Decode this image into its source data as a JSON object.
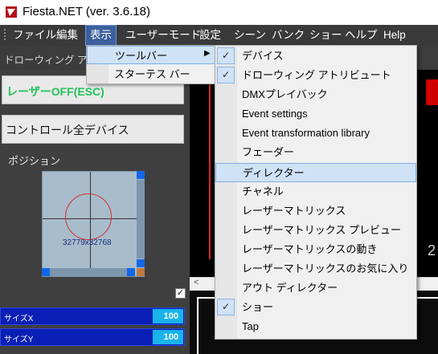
{
  "app": {
    "title": "Fiesta.NET (ver. 3.6.18)"
  },
  "menubar": {
    "items": [
      "ファイル",
      "編集",
      "表示",
      "ユーザーモード",
      "設定",
      "シーン",
      "バンク",
      "ショー",
      "ヘルプ",
      "Help"
    ],
    "active": "表示"
  },
  "toolbar": {
    "label": "ドローウィング アトリ"
  },
  "left_panel": {
    "laser_button": "レーザーOFF(ESC)",
    "control_button": "コントロール全デバイス",
    "position_label": "ポジション",
    "position_readout": "32779x32768",
    "size_x_label": "サイズX",
    "size_x_value": "100",
    "size_y_label": "サイズY",
    "size_y_value": "100"
  },
  "canvas": {
    "digit": "2"
  },
  "view_menu": {
    "items": [
      "ツールバー",
      "スターテス バー"
    ],
    "highlighted": "ツールバー"
  },
  "toolbar_submenu": {
    "items": [
      {
        "label": "デバイス",
        "checked": true
      },
      {
        "label": "ドローウィング アトリビュート",
        "checked": true
      },
      {
        "label": "DMXプレイバック",
        "checked": false
      },
      {
        "label": "Event settings",
        "checked": false
      },
      {
        "label": "Event transformation library",
        "checked": false
      },
      {
        "label": "フェーダー",
        "checked": false
      },
      {
        "label": "ディレクター",
        "checked": false,
        "highlighted": true
      },
      {
        "label": "チャネル",
        "checked": false
      },
      {
        "label": "レーザーマトリックス",
        "checked": false
      },
      {
        "label": "レーザーマトリックス プレビュー",
        "checked": false
      },
      {
        "label": "レーザーマトリックスの動き",
        "checked": false
      },
      {
        "label": "レーザーマトリックスのお気に入り",
        "checked": false
      },
      {
        "label": "アウト ディレクター",
        "checked": false
      },
      {
        "label": "ショー",
        "checked": true
      },
      {
        "label": "Tap",
        "checked": false
      }
    ]
  },
  "colors": {
    "accent": "#3c5f9e",
    "laser_green": "#22c35a",
    "slider_blue": "#0a1fb5",
    "value_cyan": "#18b3ea"
  }
}
